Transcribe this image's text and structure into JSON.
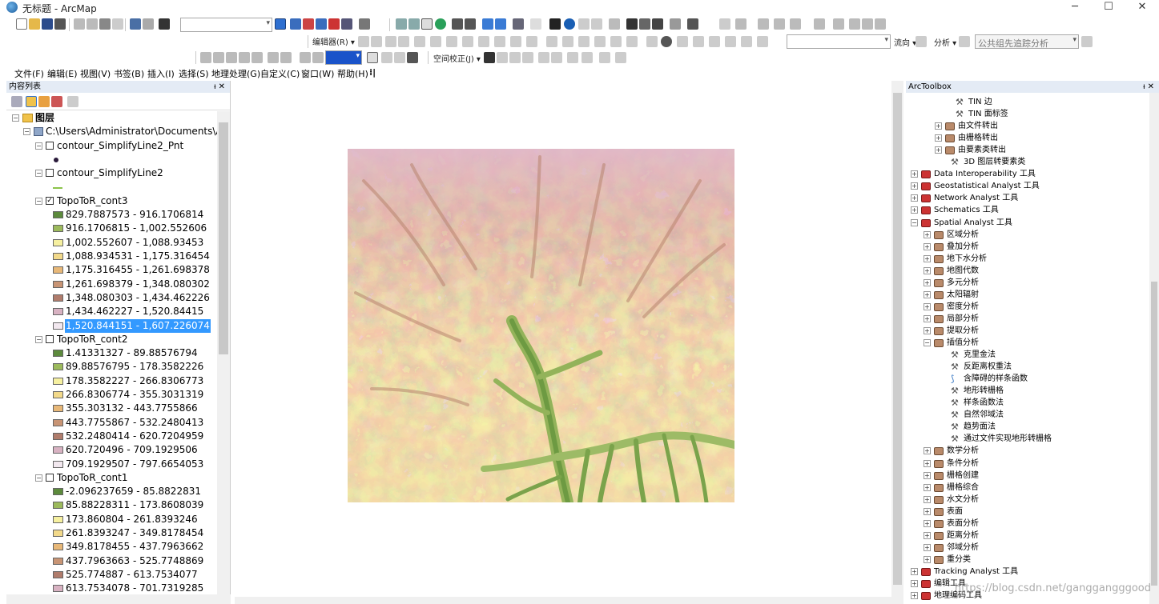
{
  "window": {
    "title": "无标题 - ArcMap",
    "minimize": "─",
    "maximize": "☐",
    "close": "✕"
  },
  "toolbar": {
    "editor_label": "编辑器(R) ▾",
    "georef_label": "空间校正(J) ▾",
    "flow_label": "流向 ▾",
    "analysis_label": "分析 ▾",
    "trace_task": "公共组先追踪分析"
  },
  "menubar": {
    "items": [
      "文件(F)",
      "编辑(E)",
      "视图(V)",
      "书签(B)",
      "插入(I)",
      "选择(S)",
      "地理处理(G)",
      "自定义(C)",
      "窗口(W)",
      "帮助(H)"
    ]
  },
  "toc": {
    "title": "内容列表",
    "root_label": "图层",
    "path_label": "C:\\Users\\Administrator\\Documents\\Arc",
    "layers": [
      {
        "name": "contour_SimplifyLine2_Pnt",
        "checked": false
      },
      {
        "name": "contour_SimplifyLine2",
        "checked": false
      },
      {
        "name": "TopoToR_cont3",
        "checked": true,
        "classes": [
          "829.7887573 - 916.1706814",
          "916.1706815 - 1,002.552606",
          "1,002.552607 - 1,088.93453",
          "1,088.934531 - 1,175.316454",
          "1,175.316455 - 1,261.698378",
          "1,261.698379 - 1,348.080302",
          "1,348.080303 - 1,434.462226",
          "1,434.462227 - 1,520.84415",
          "1,520.844151 - 1,607.226074"
        ]
      },
      {
        "name": "TopoToR_cont2",
        "checked": false,
        "classes": [
          "1.41331327 - 89.88576794",
          "89.88576795 - 178.3582226",
          "178.3582227 - 266.8306773",
          "266.8306774 - 355.3031319",
          "355.303132 - 443.7755866",
          "443.7755867 - 532.2480413",
          "532.2480414 - 620.7204959",
          "620.720496 - 709.1929506",
          "709.1929507 - 797.6654053"
        ]
      },
      {
        "name": "TopoToR_cont1",
        "checked": false,
        "classes": [
          "-2.096237659 - 85.8822831",
          "85.88228311 - 173.8608039",
          "173.860804 - 261.8393246",
          "261.8393247 - 349.8178454",
          "349.8178455 - 437.7963662",
          "437.7963663 - 525.7748869",
          "525.774887 - 613.7534077",
          "613.7534078 - 701.7319285"
        ]
      }
    ],
    "class_colors": [
      "#5c8a3c",
      "#9cba5c",
      "#f6f0a0",
      "#f2d98a",
      "#e8b878",
      "#c89474",
      "#b07c6c",
      "#d8b2c2",
      "#f2e8ef"
    ]
  },
  "arctoolbox": {
    "title": "ArcToolbox",
    "items": [
      {
        "label": "TIN 边",
        "kind": "tool",
        "indent": 3
      },
      {
        "label": "TIN 面标签",
        "kind": "tool",
        "indent": 3
      },
      {
        "label": "由文件转出",
        "kind": "set",
        "indent": 2
      },
      {
        "label": "由栅格转出",
        "kind": "set",
        "indent": 2
      },
      {
        "label": "由要素类转出",
        "kind": "set",
        "indent": 2
      },
      {
        "label": "3D 图层转要素类",
        "kind": "tool",
        "indent": 2
      },
      {
        "label": "Data Interoperability 工具",
        "kind": "box",
        "indent": 0
      },
      {
        "label": "Geostatistical Analyst 工具",
        "kind": "box",
        "indent": 0
      },
      {
        "label": "Network Analyst 工具",
        "kind": "box",
        "indent": 0
      },
      {
        "label": "Schematics 工具",
        "kind": "box",
        "indent": 0
      },
      {
        "label": "Spatial Analyst 工具",
        "kind": "box",
        "indent": 0,
        "open": true
      },
      {
        "label": "区域分析",
        "kind": "set",
        "indent": 1
      },
      {
        "label": "叠加分析",
        "kind": "set",
        "indent": 1
      },
      {
        "label": "地下水分析",
        "kind": "set",
        "indent": 1
      },
      {
        "label": "地图代数",
        "kind": "set",
        "indent": 1
      },
      {
        "label": "多元分析",
        "kind": "set",
        "indent": 1
      },
      {
        "label": "太阳辐射",
        "kind": "set",
        "indent": 1
      },
      {
        "label": "密度分析",
        "kind": "set",
        "indent": 1
      },
      {
        "label": "局部分析",
        "kind": "set",
        "indent": 1
      },
      {
        "label": "提取分析",
        "kind": "set",
        "indent": 1
      },
      {
        "label": "插值分析",
        "kind": "set",
        "indent": 1,
        "open": true
      },
      {
        "label": "克里金法",
        "kind": "tool",
        "indent": 2
      },
      {
        "label": "反距离权重法",
        "kind": "tool",
        "indent": 2
      },
      {
        "label": "含障碍的样条函数",
        "kind": "script",
        "indent": 2
      },
      {
        "label": "地形转栅格",
        "kind": "tool",
        "indent": 2
      },
      {
        "label": "样条函数法",
        "kind": "tool",
        "indent": 2
      },
      {
        "label": "自然邻域法",
        "kind": "tool",
        "indent": 2
      },
      {
        "label": "趋势面法",
        "kind": "tool",
        "indent": 2
      },
      {
        "label": "通过文件实现地形转栅格",
        "kind": "tool",
        "indent": 2
      },
      {
        "label": "数学分析",
        "kind": "set",
        "indent": 1
      },
      {
        "label": "条件分析",
        "kind": "set",
        "indent": 1
      },
      {
        "label": "栅格创建",
        "kind": "set",
        "indent": 1
      },
      {
        "label": "栅格综合",
        "kind": "set",
        "indent": 1
      },
      {
        "label": "水文分析",
        "kind": "set",
        "indent": 1
      },
      {
        "label": "表面",
        "kind": "set",
        "indent": 1
      },
      {
        "label": "表面分析",
        "kind": "set",
        "indent": 1
      },
      {
        "label": "距离分析",
        "kind": "set",
        "indent": 1
      },
      {
        "label": "邻域分析",
        "kind": "set",
        "indent": 1
      },
      {
        "label": "重分类",
        "kind": "set",
        "indent": 1
      },
      {
        "label": "Tracking Analyst 工具",
        "kind": "box",
        "indent": 0
      },
      {
        "label": "编辑工具",
        "kind": "box",
        "indent": 0
      },
      {
        "label": "地理编码工具",
        "kind": "box",
        "indent": 0
      }
    ],
    "watermark": "https://blog.csdn.net/ganggangggood"
  }
}
